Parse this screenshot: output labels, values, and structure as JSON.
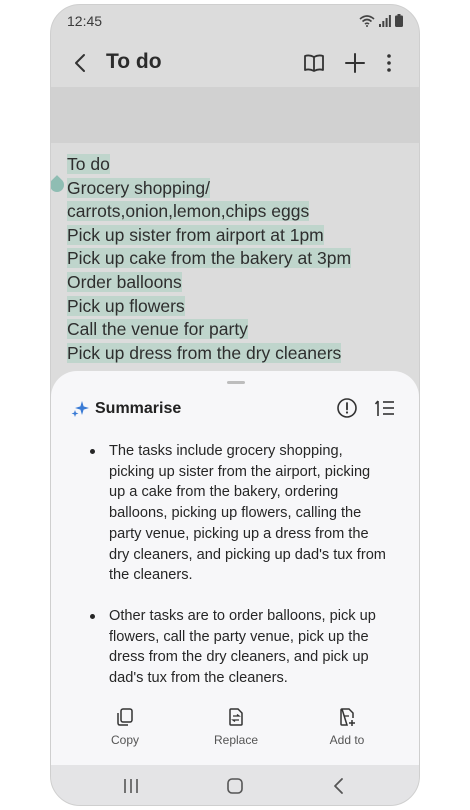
{
  "status": {
    "time": "12:45"
  },
  "header": {
    "title": "To do"
  },
  "note": {
    "lines": [
      "To do",
      "Grocery shopping/",
      "carrots,onion,lemon,chips eggs",
      "Pick up sister from airport at 1pm",
      "Pick up cake from the bakery at 3pm",
      "Order balloons",
      "Pick up flowers",
      "Call the venue for party",
      "Pick up dress from the dry cleaners"
    ]
  },
  "sheet": {
    "title": "Summarise",
    "bullets": [
      "The tasks include grocery shopping, picking up sister from the airport, picking up a cake from the bakery, ordering balloons, picking up flowers, calling the party venue, picking up a dress from the dry cleaners, and picking up dad's tux from the cleaners.",
      "Other tasks are to order balloons, pick up flowers, call the party venue, pick up the dress from the dry cleaners, and pick up dad's tux from the cleaners."
    ],
    "actions": {
      "copy": "Copy",
      "replace": "Replace",
      "add_to": "Add to"
    }
  }
}
